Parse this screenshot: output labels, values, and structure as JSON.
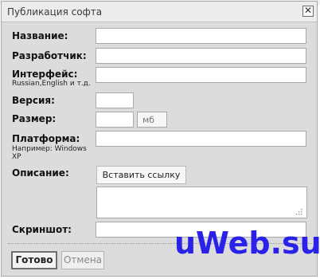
{
  "dialog": {
    "title": "Публикация софта",
    "close_glyph": "✕"
  },
  "form": {
    "name_label": "Название:",
    "developer_label": "Разработчик:",
    "interface_label": "Интерфейс:",
    "interface_hint": "Russian,English и т.д.",
    "version_label": "Версия:",
    "size_label": "Размер:",
    "size_unit": "мб",
    "platform_label": "Платформа:",
    "platform_hint_line1": "Например: Windows",
    "platform_hint_line2": "XP",
    "description_label": "Описание:",
    "insert_link_label": "Вставить ссылку",
    "screenshot_label": "Скриншот:",
    "name_value": "",
    "developer_value": "",
    "interface_value": "",
    "version_value": "",
    "size_value": "",
    "platform_value": "",
    "description_value": "",
    "screenshot_value": ""
  },
  "footer": {
    "ok_label": "Готово",
    "cancel_label": "Отмена"
  },
  "watermark": "uWeb.su",
  "colors": {
    "dialog_bg": "#dcdcdc",
    "watermark": "#2a22e8"
  }
}
